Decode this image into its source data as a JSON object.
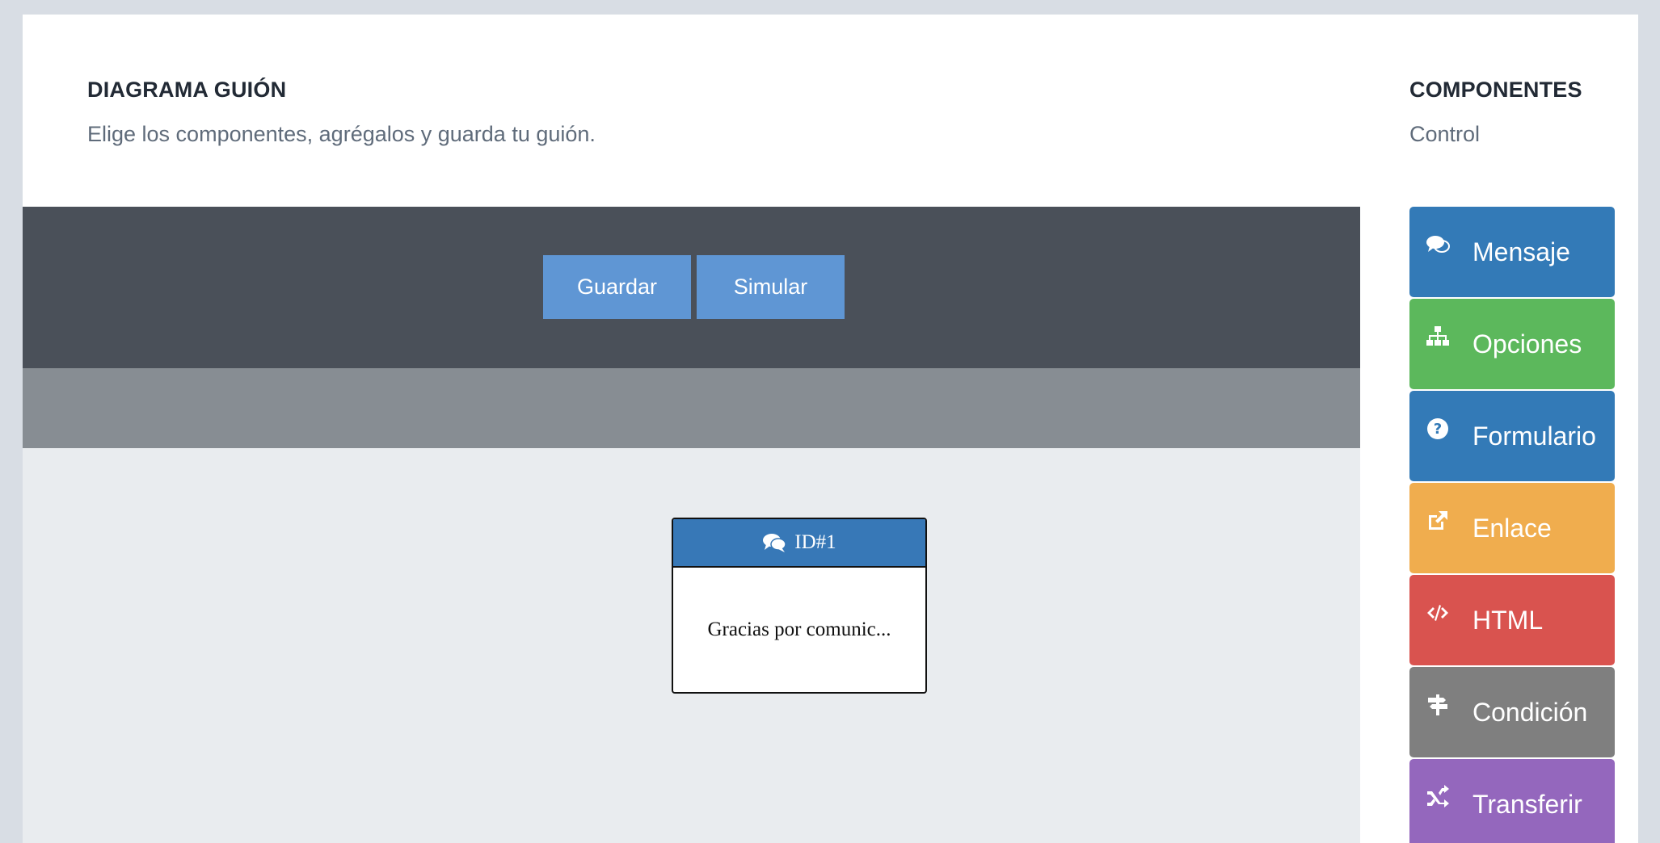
{
  "header": {
    "title": "DIAGRAMA GUIÓN",
    "subtitle": "Elige los componentes, agrégalos y guarda tu guión."
  },
  "components_header": {
    "title": "COMPONENTES",
    "subtitle": "Control"
  },
  "toolbar": {
    "save_label": "Guardar",
    "simulate_label": "Simular"
  },
  "node": {
    "id_label": "ID#1",
    "body_text": "Gracias por comunic..."
  },
  "components": [
    {
      "label": "Mensaje",
      "icon": "comments-icon",
      "color": "#337ab7"
    },
    {
      "label": "Opciones",
      "icon": "sitemap-icon",
      "color": "#5cb85c"
    },
    {
      "label": "Formulario",
      "icon": "question-circle-icon",
      "color": "#337ab7"
    },
    {
      "label": "Enlace",
      "icon": "external-link-icon",
      "color": "#f0ad4e"
    },
    {
      "label": "HTML",
      "icon": "code-icon",
      "color": "#d9534f"
    },
    {
      "label": "Condición",
      "icon": "signpost-icon",
      "color": "#7f7f7f"
    },
    {
      "label": "Transferir",
      "icon": "random-icon",
      "color": "#9467bd"
    }
  ]
}
